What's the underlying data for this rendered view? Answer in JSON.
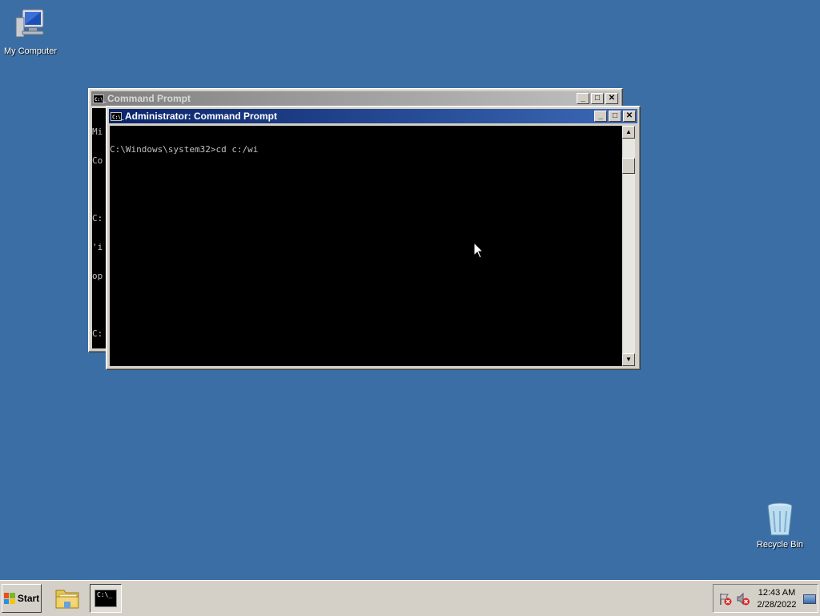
{
  "desktop": {
    "icons": [
      {
        "label": "My Computer",
        "icon": "computer-icon"
      },
      {
        "label": "Recycle Bin",
        "icon": "recycle-bin-icon"
      }
    ]
  },
  "windows": {
    "back": {
      "title": "Command Prompt",
      "lines": [
        "Mi",
        "Co",
        "",
        "C:",
        "'i",
        "op",
        "",
        "C:"
      ]
    },
    "front": {
      "title": "Administrator: Command Prompt",
      "lines": [
        "C:\\Windows\\system32>cd c:/wi"
      ]
    },
    "buttons": {
      "minimize": "_",
      "maximize": "□",
      "close": "✕"
    },
    "icon_text": "C:\\_"
  },
  "taskbar": {
    "start_label": "Start",
    "clock_time": "12:43 AM",
    "clock_date": "2/28/2022",
    "items": [
      "explorer-icon",
      "cmd-icon"
    ]
  },
  "colors": {
    "desktop": "#3a6ea5",
    "title_active": "#0a246a",
    "title_inactive": "#808080",
    "face": "#d4d0c8"
  }
}
